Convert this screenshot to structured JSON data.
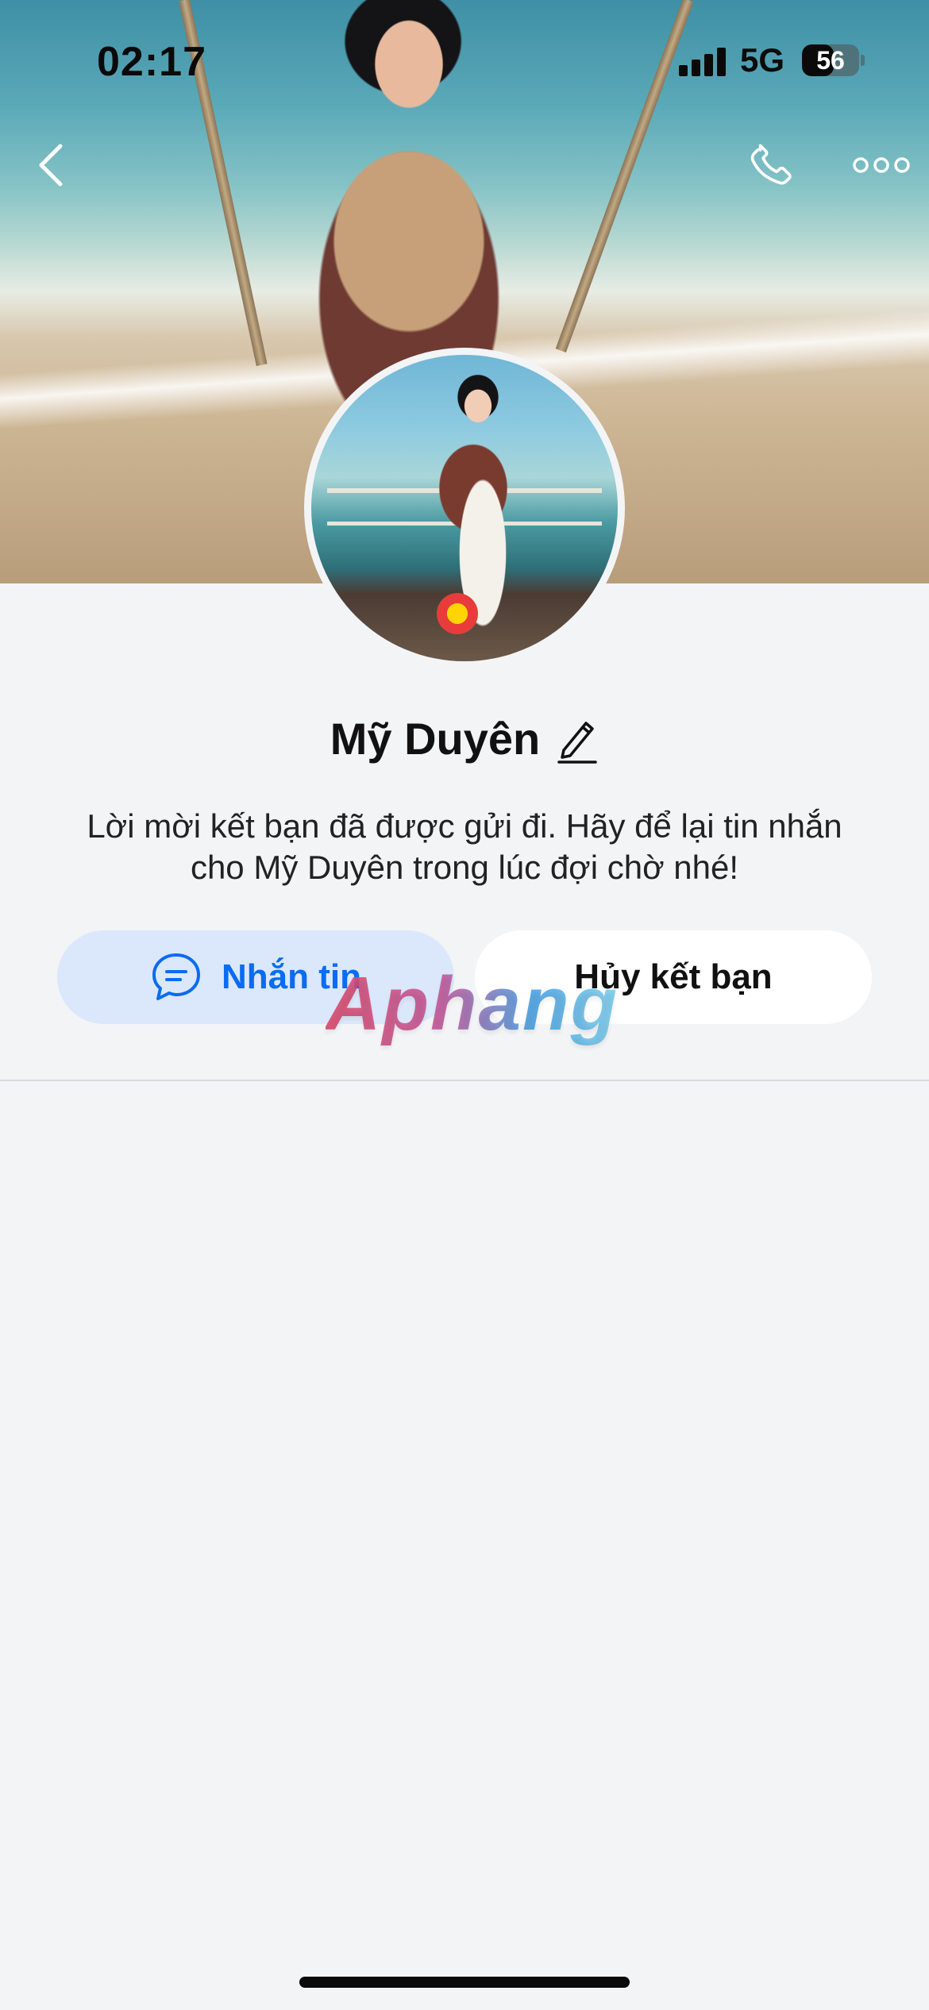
{
  "status_bar": {
    "time": "02:17",
    "network": "5G",
    "battery_percent": "56",
    "battery_level": 0.56,
    "signal_bars": 4
  },
  "nav": {
    "back_icon": "chevron-left-icon",
    "call_icon": "phone-icon",
    "more_icon": "more-horizontal-icon"
  },
  "profile": {
    "name": "Mỹ Duyên",
    "edit_icon": "pencil-icon",
    "description": "Lời mời kết bạn đã được gửi đi. Hãy để lại tin nhắn cho Mỹ Duyên trong lúc đợi chờ nhé!"
  },
  "actions": {
    "message_label": "Nhắn tin",
    "message_icon": "chat-bubble-icon",
    "cancel_label": "Hủy kết bạn"
  },
  "watermark": {
    "text": "Aphang"
  },
  "colors": {
    "accent": "#0a6cf0",
    "message_button_bg": "#dbe8fb",
    "page_bg": "#f3f4f6"
  }
}
